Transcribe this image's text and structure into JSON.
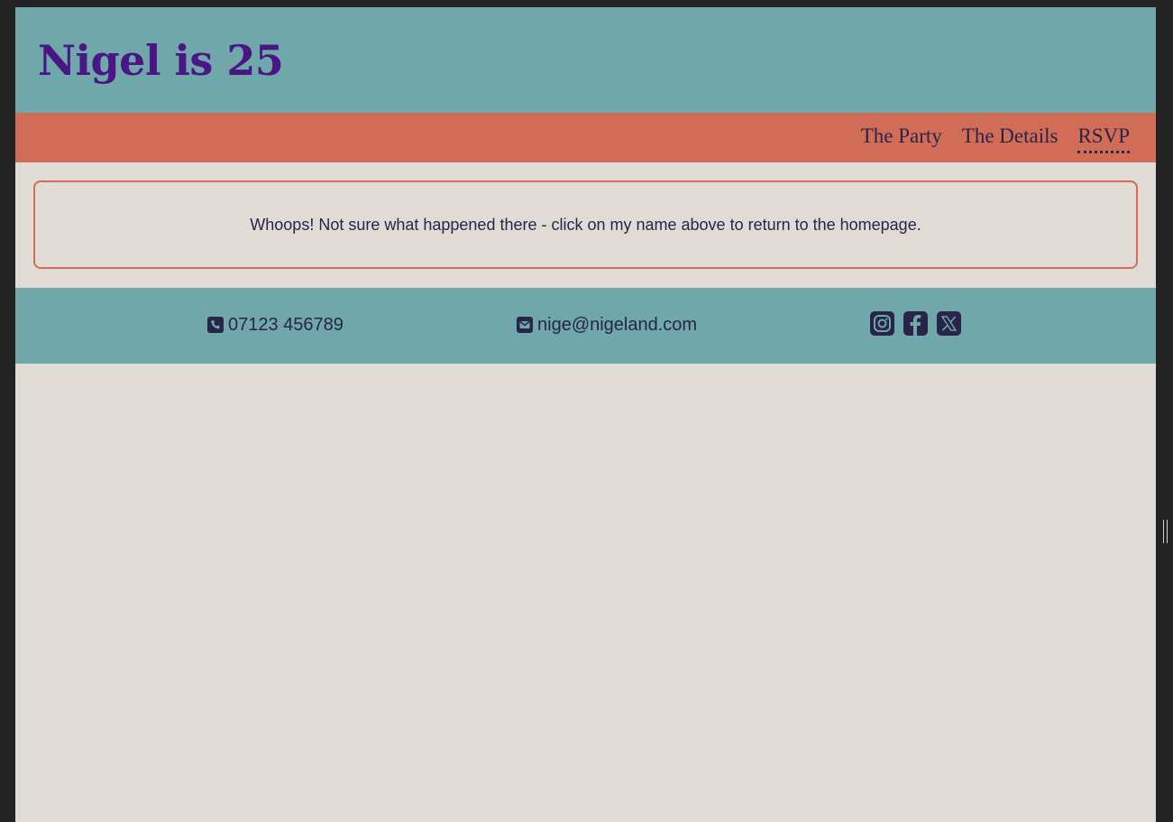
{
  "header": {
    "title": "Nigel is 25"
  },
  "nav": {
    "items": [
      {
        "label": "The Party"
      },
      {
        "label": "The Details"
      },
      {
        "label": "RSVP"
      }
    ]
  },
  "main": {
    "error_message": "Whoops! Not sure what happened there - click on my name above to return to the homepage."
  },
  "footer": {
    "phone": "07123 456789",
    "email": "nige@nigeland.com",
    "socials": [
      "instagram-icon",
      "facebook-icon",
      "x-icon"
    ]
  },
  "colors": {
    "header_bg": "#6fa7ab",
    "nav_bg": "#d16d57",
    "page_bg": "#e1dbd6",
    "title": "#4a1585",
    "text": "#28244a"
  }
}
